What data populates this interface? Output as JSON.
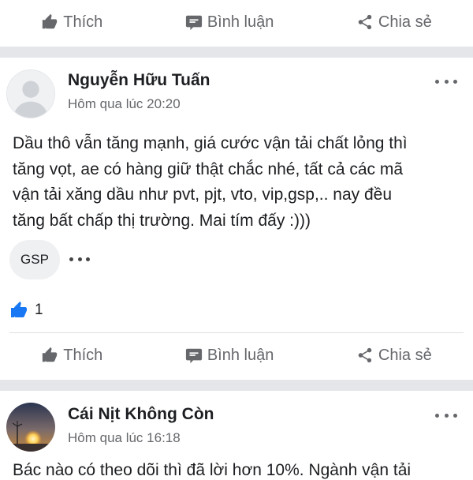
{
  "actions": {
    "like_label": "Thích",
    "comment_label": "Bình luận",
    "share_label": "Chia sẻ"
  },
  "post1": {
    "author": "Nguyễn Hữu Tuấn",
    "time": "Hôm qua lúc 20:20",
    "text_lines": [
      "Dầu thô vẫn tăng mạnh, giá cước vận tải chất lỏng thì",
      "tăng vọt, ae có hàng giữ thật chắc nhé, tất cả các mã",
      "vận tải xăng dầu như pvt, pjt, vto, vip,gsp,.. nay đều",
      "tăng bất chấp thị trường. Mai tím đấy :)))"
    ],
    "tag": "GSP",
    "like_count": "1"
  },
  "post2": {
    "author": "Cái Nịt Không Còn",
    "time": "Hôm qua lúc 16:18",
    "text_partial": "Bác nào có theo dõi thì đã lời hơn 10%. Ngành vận tải"
  },
  "icons": {
    "like": "thumbs-up-icon",
    "comment": "comment-icon",
    "share": "share-icon",
    "more": "more-horizontal-icon"
  },
  "colors": {
    "accent": "#1877f2",
    "muted_text": "#65676b",
    "separator": "#e4e6ea"
  }
}
